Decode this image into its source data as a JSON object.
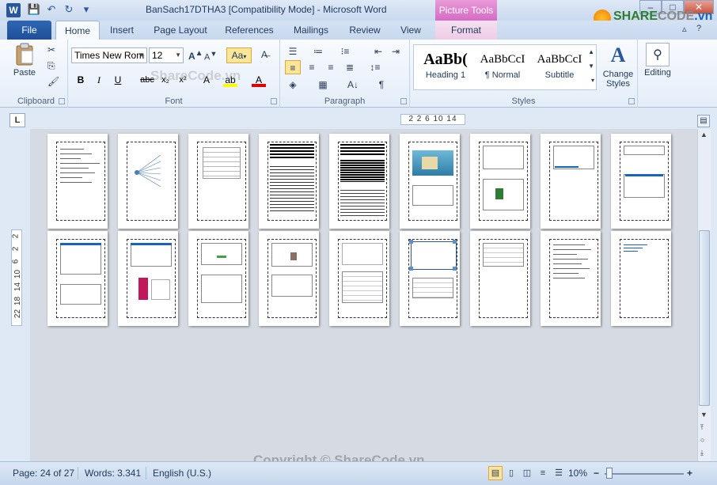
{
  "window": {
    "app_icon": "W",
    "title": "BanSach17DTHA3 [Compatibility Mode] - Microsoft Word",
    "context_tab_group": "Picture Tools",
    "controls": {
      "minimize": "–",
      "maximize": "□",
      "close": "✕"
    },
    "brand": {
      "share": "SHARE",
      "code": "CODE",
      "vn": ".vn"
    }
  },
  "tabs": [
    {
      "label": "File"
    },
    {
      "label": "Home"
    },
    {
      "label": "Insert"
    },
    {
      "label": "Page Layout"
    },
    {
      "label": "References"
    },
    {
      "label": "Mailings"
    },
    {
      "label": "Review"
    },
    {
      "label": "View"
    },
    {
      "label": "Format"
    }
  ],
  "ribbon": {
    "clipboard": {
      "label": "Clipboard",
      "paste": "Paste"
    },
    "font": {
      "label": "Font",
      "font_name": "Times New Rom",
      "font_size": "12",
      "change_case": "Aa",
      "bold": "B",
      "italic": "I",
      "underline": "U",
      "strike": "abc",
      "subscript": "x₂",
      "superscript": "x²"
    },
    "paragraph": {
      "label": "Paragraph",
      "pilcrow": "¶"
    },
    "styles": {
      "label": "Styles",
      "items": [
        {
          "sample": "AaBb(",
          "name": "Heading 1"
        },
        {
          "sample": "AaBbCcI",
          "name": "¶ Normal"
        },
        {
          "sample": "AaBbCcI",
          "name": "Subtitle"
        }
      ],
      "change_styles": "Change Styles"
    },
    "editing": {
      "label": "Editing"
    }
  },
  "ruler": {
    "tab_selector": "L",
    "marks": "2 2 6 10 14",
    "vertical_marks": [
      "2",
      "2",
      "6",
      "10",
      "14",
      "18",
      "22"
    ]
  },
  "status": {
    "page": "Page: 24 of 27",
    "words": "Words: 3.341",
    "language": "English (U.S.)",
    "zoom": "10%",
    "zoom_minus": "−",
    "zoom_plus": "+"
  },
  "watermark": "Copyright © ShareCode.vn",
  "watermark_top": "ShareCode.vn",
  "colors": {
    "file_tab": "#2a5ca8",
    "picture_tools": "#d66bc4",
    "highlight": "#fde59a"
  }
}
